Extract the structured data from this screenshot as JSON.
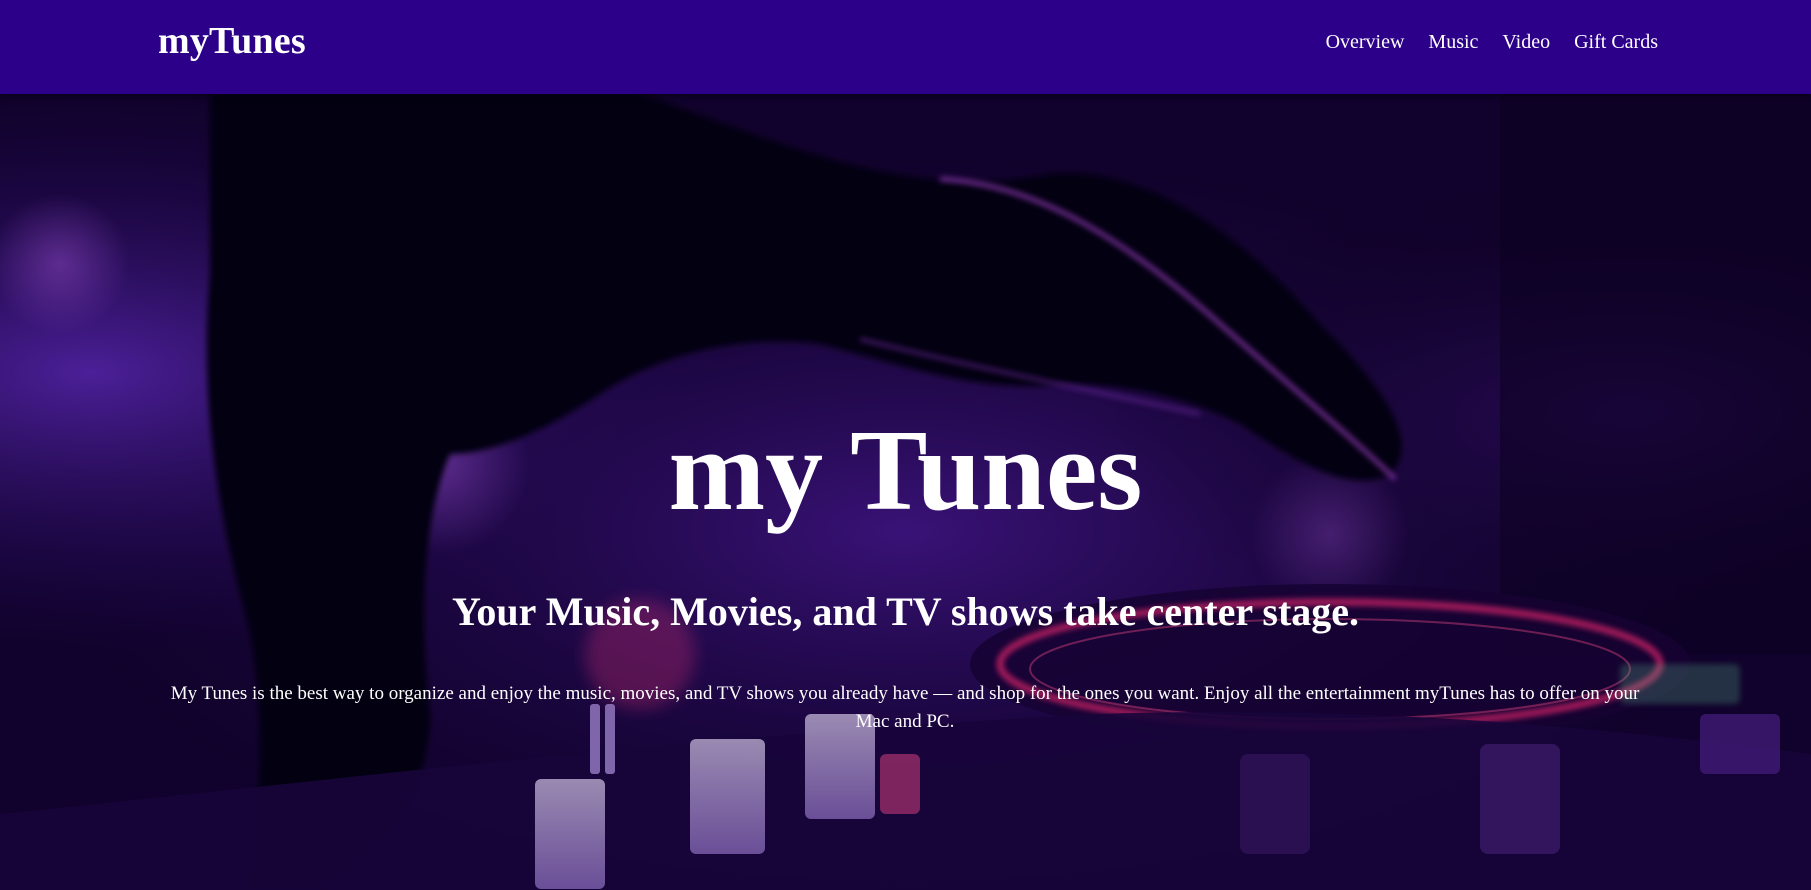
{
  "navbar": {
    "brand": "myTunes",
    "links": [
      {
        "label": "Overview"
      },
      {
        "label": "Music"
      },
      {
        "label": "Video"
      },
      {
        "label": "Gift Cards"
      }
    ]
  },
  "hero": {
    "title": "my Tunes",
    "subtitle": "Your Music, Movies, and TV shows take center stage.",
    "description": "My Tunes is the best way to organize and enjoy the music, movies, and TV shows you already have — and shop for the ones you want. Enjoy all the entertainment myTunes has to offer on your Mac and PC."
  },
  "colors": {
    "navbar_bg": "#2c0089",
    "hero_tint": "#3a0a8c",
    "accent_pink": "#ff2a7a",
    "text": "#ffffff"
  }
}
